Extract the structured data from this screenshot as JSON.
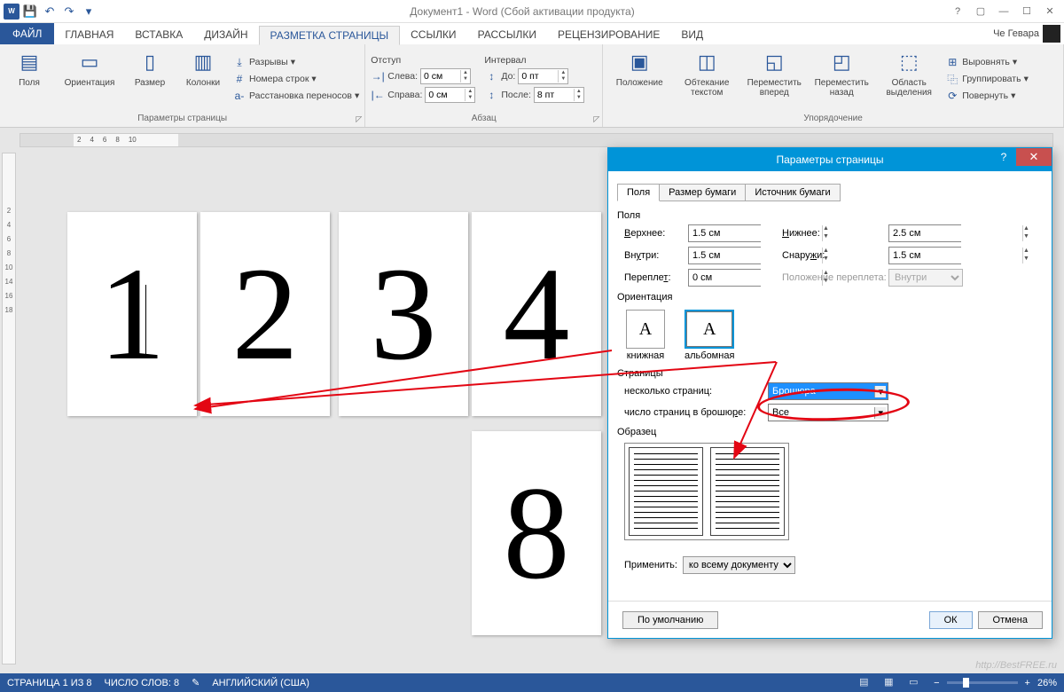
{
  "title": "Документ1 - Word (Сбой активации продукта)",
  "qat": {
    "undo": "↶",
    "redo": "↷"
  },
  "tabs": {
    "file": "ФАЙЛ",
    "home": "ГЛАВНАЯ",
    "insert": "ВСТАВКА",
    "design": "ДИЗАЙН",
    "layout": "РАЗМЕТКА СТРАНИЦЫ",
    "refs": "ССЫЛКИ",
    "mail": "РАССЫЛКИ",
    "review": "РЕЦЕНЗИРОВАНИЕ",
    "view": "ВИД"
  },
  "user": "Че Гевара",
  "ribbon": {
    "page_setup": {
      "margins": "Поля",
      "orientation": "Ориентация",
      "size": "Размер",
      "columns": "Колонки",
      "breaks": "Разрывы",
      "line_numbers": "Номера строк",
      "hyphenation": "Расстановка переносов",
      "group": "Параметры страницы"
    },
    "paragraph": {
      "indent_h": "Отступ",
      "left": "Слева:",
      "right": "Справа:",
      "left_v": "0 см",
      "right_v": "0 см",
      "spacing_h": "Интервал",
      "before": "До:",
      "after": "После:",
      "before_v": "0 пт",
      "after_v": "8 пт",
      "group": "Абзац"
    },
    "arrange": {
      "position": "Положение",
      "wrap": "Обтекание текстом",
      "forward": "Переместить вперед",
      "backward": "Переместить назад",
      "selpane": "Область выделения",
      "align": "Выровнять",
      "group_btn": "Группировать",
      "rotate": "Повернуть",
      "group": "Упорядочение"
    }
  },
  "ruler": [
    "2",
    "4",
    "6",
    "8",
    "10"
  ],
  "vruler": [
    "2",
    "4",
    "6",
    "8",
    "10",
    "14",
    "16",
    "18"
  ],
  "pages": {
    "p1": "1",
    "p2": "2",
    "p3": "3",
    "p4": "4",
    "p8": "8"
  },
  "dialog": {
    "title": "Параметры страницы",
    "tabs": {
      "fields": "Поля",
      "paper": "Размер бумаги",
      "source": "Источник бумаги"
    },
    "sec_fields": "Поля",
    "top": "Верхнее:",
    "top_v": "1.5 см",
    "bottom": "Нижнее:",
    "bottom_v": "2.5 см",
    "inside": "Внутри:",
    "inside_v": "1.5 см",
    "outside": "Снаружи:",
    "outside_v": "1.5 см",
    "gutter": "Переплет:",
    "gutter_v": "0 см",
    "gutter_pos": "Положение переплета:",
    "gutter_pos_v": "Внутри",
    "sec_orient": "Ориентация",
    "portrait": "книжная",
    "landscape": "альбомная",
    "sec_pages": "Страницы",
    "multi": "несколько страниц:",
    "multi_v": "Брошюра",
    "sheets": "число страниц в брошюре:",
    "sheets_v": "Все",
    "sec_preview": "Образец",
    "apply": "Применить:",
    "apply_v": "ко всему документу",
    "default": "По умолчанию",
    "ok": "ОК",
    "cancel": "Отмена"
  },
  "status": {
    "page": "СТРАНИЦА 1 ИЗ 8",
    "words": "ЧИСЛО СЛОВ: 8",
    "lang": "АНГЛИЙСКИЙ (США)",
    "zoom": "26%"
  },
  "watermark": "http://BestFREE.ru"
}
